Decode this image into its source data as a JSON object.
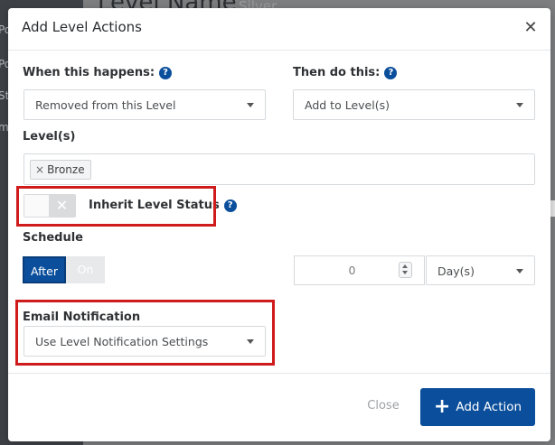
{
  "background": {
    "heading": "Level Name",
    "subheading": "Silver",
    "sidebar_fragments": [
      "Po",
      "Po",
      "St",
      "m"
    ]
  },
  "modal": {
    "title": "Add Level Actions",
    "close_icon": "close-icon",
    "trigger": {
      "label": "When this happens:",
      "selected": "Removed from this Level"
    },
    "action": {
      "label": "Then do this:",
      "selected": "Add to Level(s)"
    },
    "levels": {
      "label": "Level(s)",
      "tags": [
        "Bronze"
      ]
    },
    "inherit": {
      "label": "Inherit Level Status",
      "enabled": false
    },
    "schedule": {
      "label": "Schedule",
      "options": [
        "After",
        "On"
      ],
      "selected": "After",
      "amount": "0",
      "unit": "Day(s)"
    },
    "email": {
      "label": "Email Notification",
      "selected": "Use Level Notification Settings"
    },
    "footer": {
      "close_label": "Close",
      "add_label": "Add Action"
    }
  },
  "colors": {
    "primary": "#0b4f9c",
    "highlight": "#cf1b1b"
  }
}
